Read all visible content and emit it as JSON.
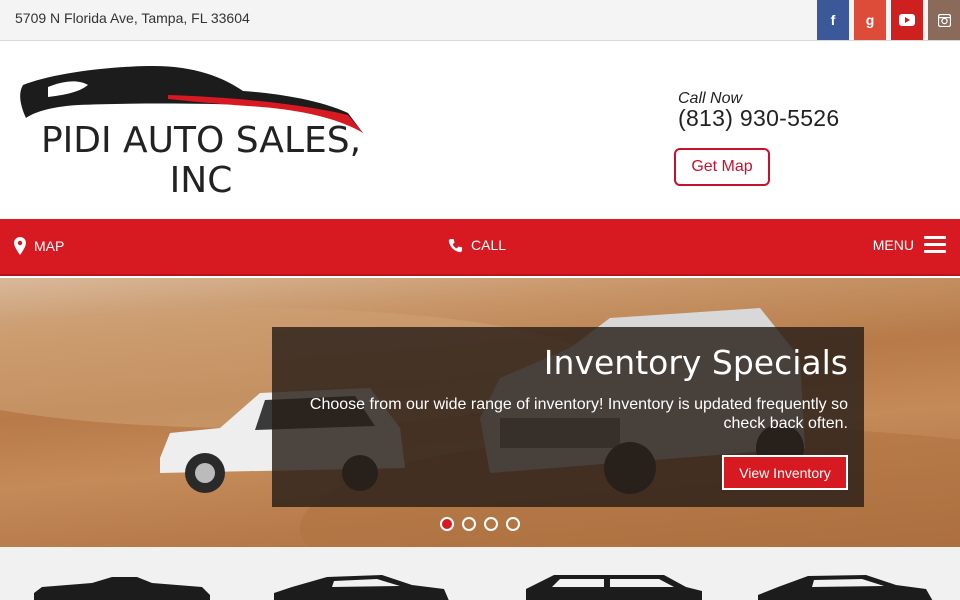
{
  "topbar": {
    "address": "5709 N Florida Ave, Tampa, FL 33604",
    "social": [
      {
        "icon": "facebook-icon",
        "glyph": "f",
        "color": "#3b5998"
      },
      {
        "icon": "google-plus-icon",
        "glyph": "g",
        "color": "#dd4b39"
      },
      {
        "icon": "youtube-icon",
        "glyph": "▶",
        "color": "#cd201f"
      },
      {
        "icon": "instagram-icon",
        "glyph": "◘",
        "color": "#8a6a5a"
      }
    ]
  },
  "header": {
    "logo_text": "PIDI AUTO SALES, INC",
    "call_now_label": "Call Now",
    "phone": "(813) 930-5526",
    "get_map_label": "Get Map"
  },
  "nav": {
    "map_label": "MAP",
    "call_label": "CALL",
    "menu_label": "MENU",
    "accent_color": "#d71a21"
  },
  "hero": {
    "title": "Inventory Specials",
    "description": "Choose from our wide range of inventory! Inventory is updated frequently so check back often.",
    "button_label": "View Inventory",
    "slide_count": 4,
    "active_slide": 1
  }
}
